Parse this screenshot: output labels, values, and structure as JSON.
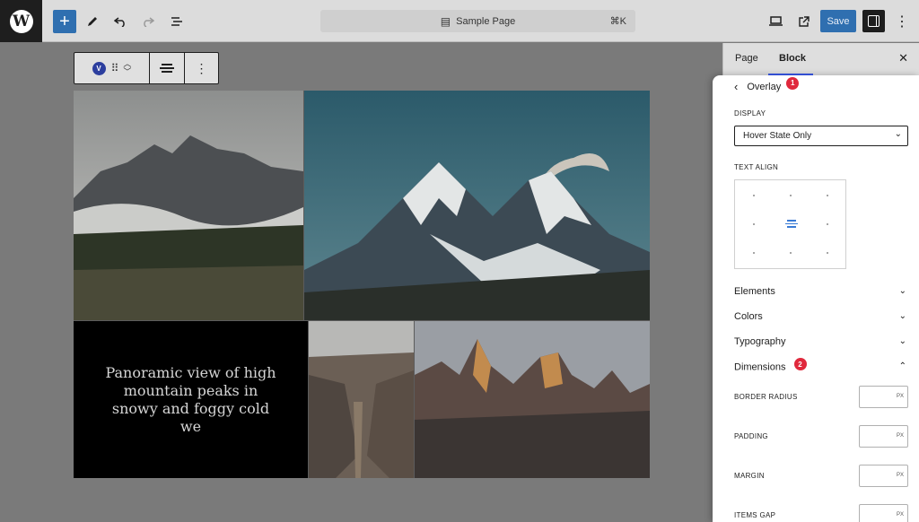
{
  "toolbar": {
    "logo": "W",
    "add_label": "+",
    "page_title": "Sample Page",
    "shortcut": "⌘K",
    "save_label": "Save"
  },
  "block_toolbar": {
    "badge": "V"
  },
  "gallery": {
    "caption": "Panoramic view of high mountain peaks in snowy and foggy cold we"
  },
  "sidebar": {
    "tabs": {
      "page": "Page",
      "block": "Block"
    },
    "close": "✕",
    "panel_title": "Overlay",
    "badge_1": "1",
    "display_label": "DISPLAY",
    "display_value": "Hover State Only",
    "text_align_label": "TEXT ALIGN",
    "sections": {
      "elements": "Elements",
      "colors": "Colors",
      "typography": "Typography",
      "dimensions": "Dimensions"
    },
    "badge_2": "2",
    "fields": {
      "border_radius": "BORDER RADIUS",
      "padding": "PADDING",
      "margin": "MARGIN",
      "items_gap": "ITEMS GAP",
      "unit": "PX"
    }
  },
  "colors": {
    "accent": "#2f6fb0",
    "badge_red": "#e0283c",
    "tab_underline": "#3858e9"
  }
}
